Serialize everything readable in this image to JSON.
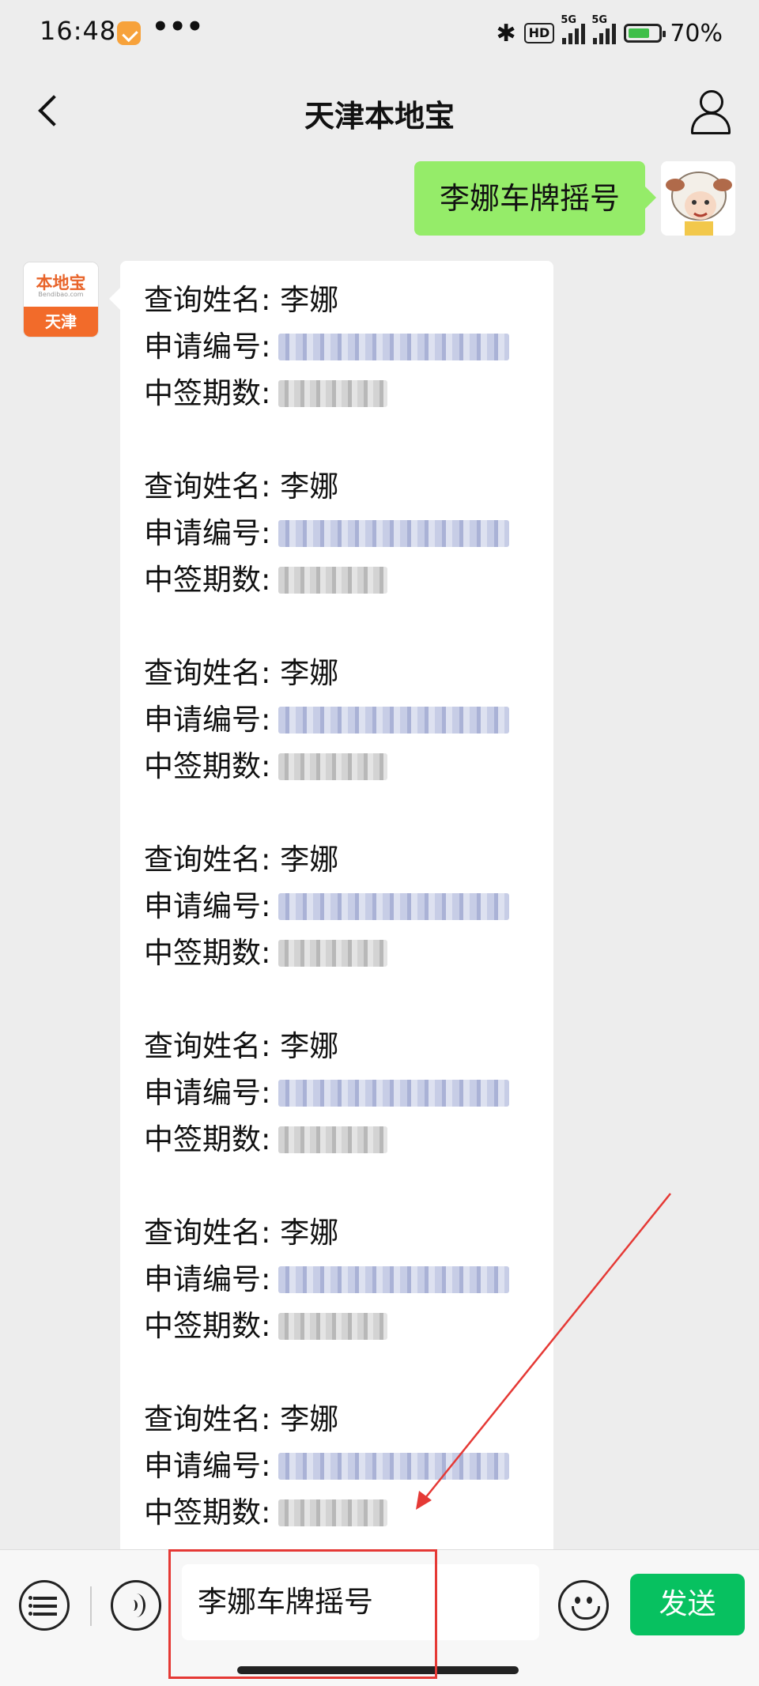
{
  "status_bar": {
    "time": "16:48",
    "more": "•••",
    "hd": "HD",
    "net1": "5G",
    "net2": "5G",
    "battery": "70%"
  },
  "nav": {
    "title": "天津本地宝"
  },
  "messages": {
    "sent": "李娜车牌摇号",
    "bot_avatar": {
      "logo": "本地宝",
      "sub": "Bendibao.com",
      "city": "天津"
    },
    "records": [
      {
        "name_label": "查询姓名:",
        "name": "李娜",
        "apply_label": "申请编号:",
        "period_label": "中签期数:"
      },
      {
        "name_label": "查询姓名:",
        "name": "李娜",
        "apply_label": "申请编号:",
        "period_label": "中签期数:"
      },
      {
        "name_label": "查询姓名:",
        "name": "李娜",
        "apply_label": "申请编号:",
        "period_label": "中签期数:"
      },
      {
        "name_label": "查询姓名:",
        "name": "李娜",
        "apply_label": "申请编号:",
        "period_label": "中签期数:"
      },
      {
        "name_label": "查询姓名:",
        "name": "李娜",
        "apply_label": "申请编号:",
        "period_label": "中签期数:"
      },
      {
        "name_label": "查询姓名:",
        "name": "李娜",
        "apply_label": "申请编号:",
        "period_label": "中签期数:"
      },
      {
        "name_label": "查询姓名:",
        "name": "李娜",
        "apply_label": "申请编号:",
        "period_label": "中签期数:"
      }
    ]
  },
  "input_bar": {
    "text": "李娜车牌摇号",
    "send_label": "发送"
  },
  "colors": {
    "sent_bubble": "#95ec69",
    "send_button": "#07c160",
    "annotation": "#e53935",
    "brand": "#f26b2a"
  },
  "icons": [
    "back-icon",
    "user-profile-icon",
    "menu-list-icon",
    "voice-icon",
    "emoji-icon"
  ]
}
